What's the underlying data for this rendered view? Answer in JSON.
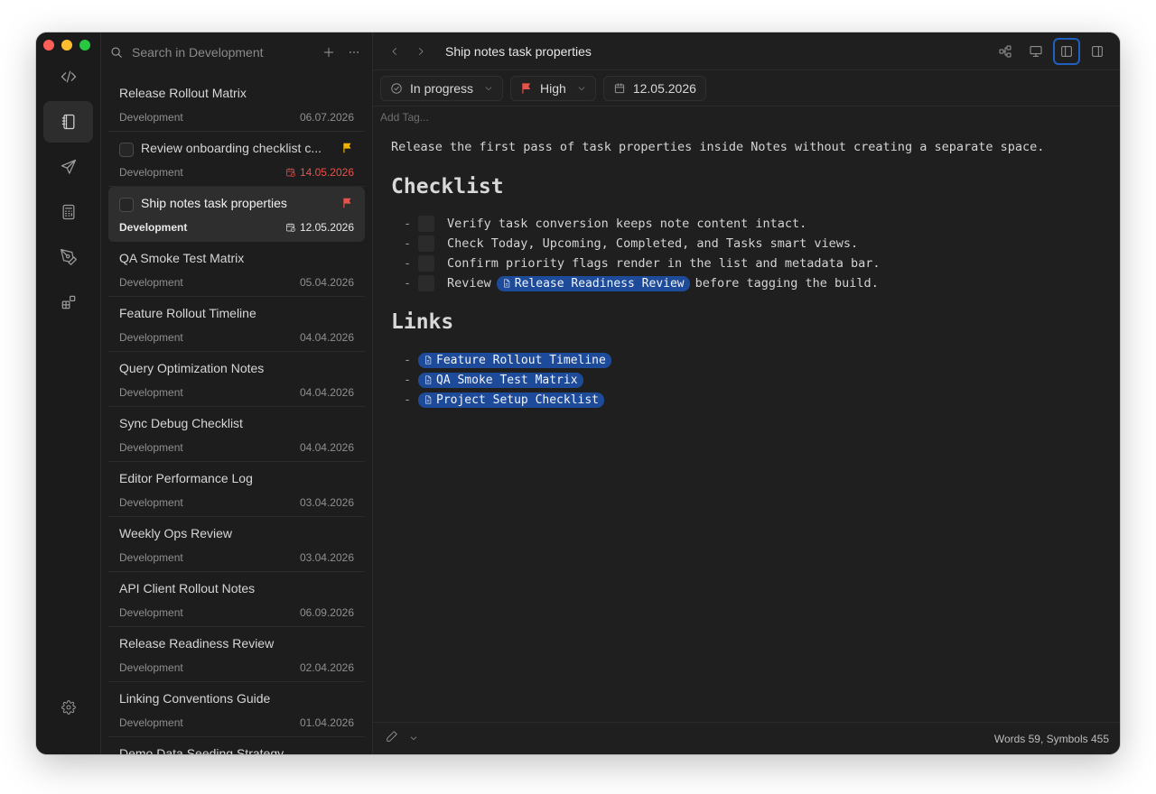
{
  "search": {
    "placeholder": "Search in Development"
  },
  "notes": [
    {
      "title": "Release Rollout Matrix",
      "folder": "Development",
      "date": "06.07.2026"
    },
    {
      "title": "Review onboarding checklist c...",
      "folder": "Development",
      "date": "14.05.2026"
    },
    {
      "title": "Ship notes task properties",
      "folder": "Development",
      "date": "12.05.2026"
    },
    {
      "title": "QA Smoke Test Matrix",
      "folder": "Development",
      "date": "05.04.2026"
    },
    {
      "title": "Feature Rollout Timeline",
      "folder": "Development",
      "date": "04.04.2026"
    },
    {
      "title": "Query Optimization Notes",
      "folder": "Development",
      "date": "04.04.2026"
    },
    {
      "title": "Sync Debug Checklist",
      "folder": "Development",
      "date": "04.04.2026"
    },
    {
      "title": "Editor Performance Log",
      "folder": "Development",
      "date": "03.04.2026"
    },
    {
      "title": "Weekly Ops Review",
      "folder": "Development",
      "date": "03.04.2026"
    },
    {
      "title": "API Client Rollout Notes",
      "folder": "Development",
      "date": "06.09.2026"
    },
    {
      "title": "Release Readiness Review",
      "folder": "Development",
      "date": "02.04.2026"
    },
    {
      "title": "Linking Conventions Guide",
      "folder": "Development",
      "date": "01.04.2026"
    },
    {
      "title": "Demo Data Seeding Strategy",
      "folder": "",
      "date": ""
    }
  ],
  "editor": {
    "title": "Ship notes task properties",
    "status": "In progress",
    "priority": "High",
    "due": "12.05.2026",
    "add_tag": "Add Tag...",
    "intro": "Release the first pass of task properties inside Notes without creating a separate space.",
    "checklist_heading": "Checklist",
    "checklist": [
      {
        "text": "Verify task conversion keeps note content intact."
      },
      {
        "text": "Check Today, Upcoming, Completed, and Tasks smart views."
      },
      {
        "text": "Confirm priority flags render in the list and metadata bar."
      },
      {
        "pre": "Review",
        "link": "Release Readiness Review",
        "post": "before tagging the build."
      }
    ],
    "links_heading": "Links",
    "links": [
      "Feature Rollout Timeline",
      "QA Smoke Test Matrix",
      "Project Setup Checklist"
    ],
    "stats": "Words 59, Symbols 455",
    "dash": "-"
  },
  "colors": {
    "overdue": "#e5534b",
    "flag_red": "#e5534b",
    "flag_yellow": "#f0b400",
    "link_pill": "#1d4b9a",
    "focus_ring": "#1f5fbf"
  },
  "icons": {
    "rail": [
      "code-icon",
      "notebook-icon",
      "send-icon",
      "calculator-icon",
      "pen-tool-icon",
      "widgets-icon",
      "gear-icon"
    ]
  }
}
